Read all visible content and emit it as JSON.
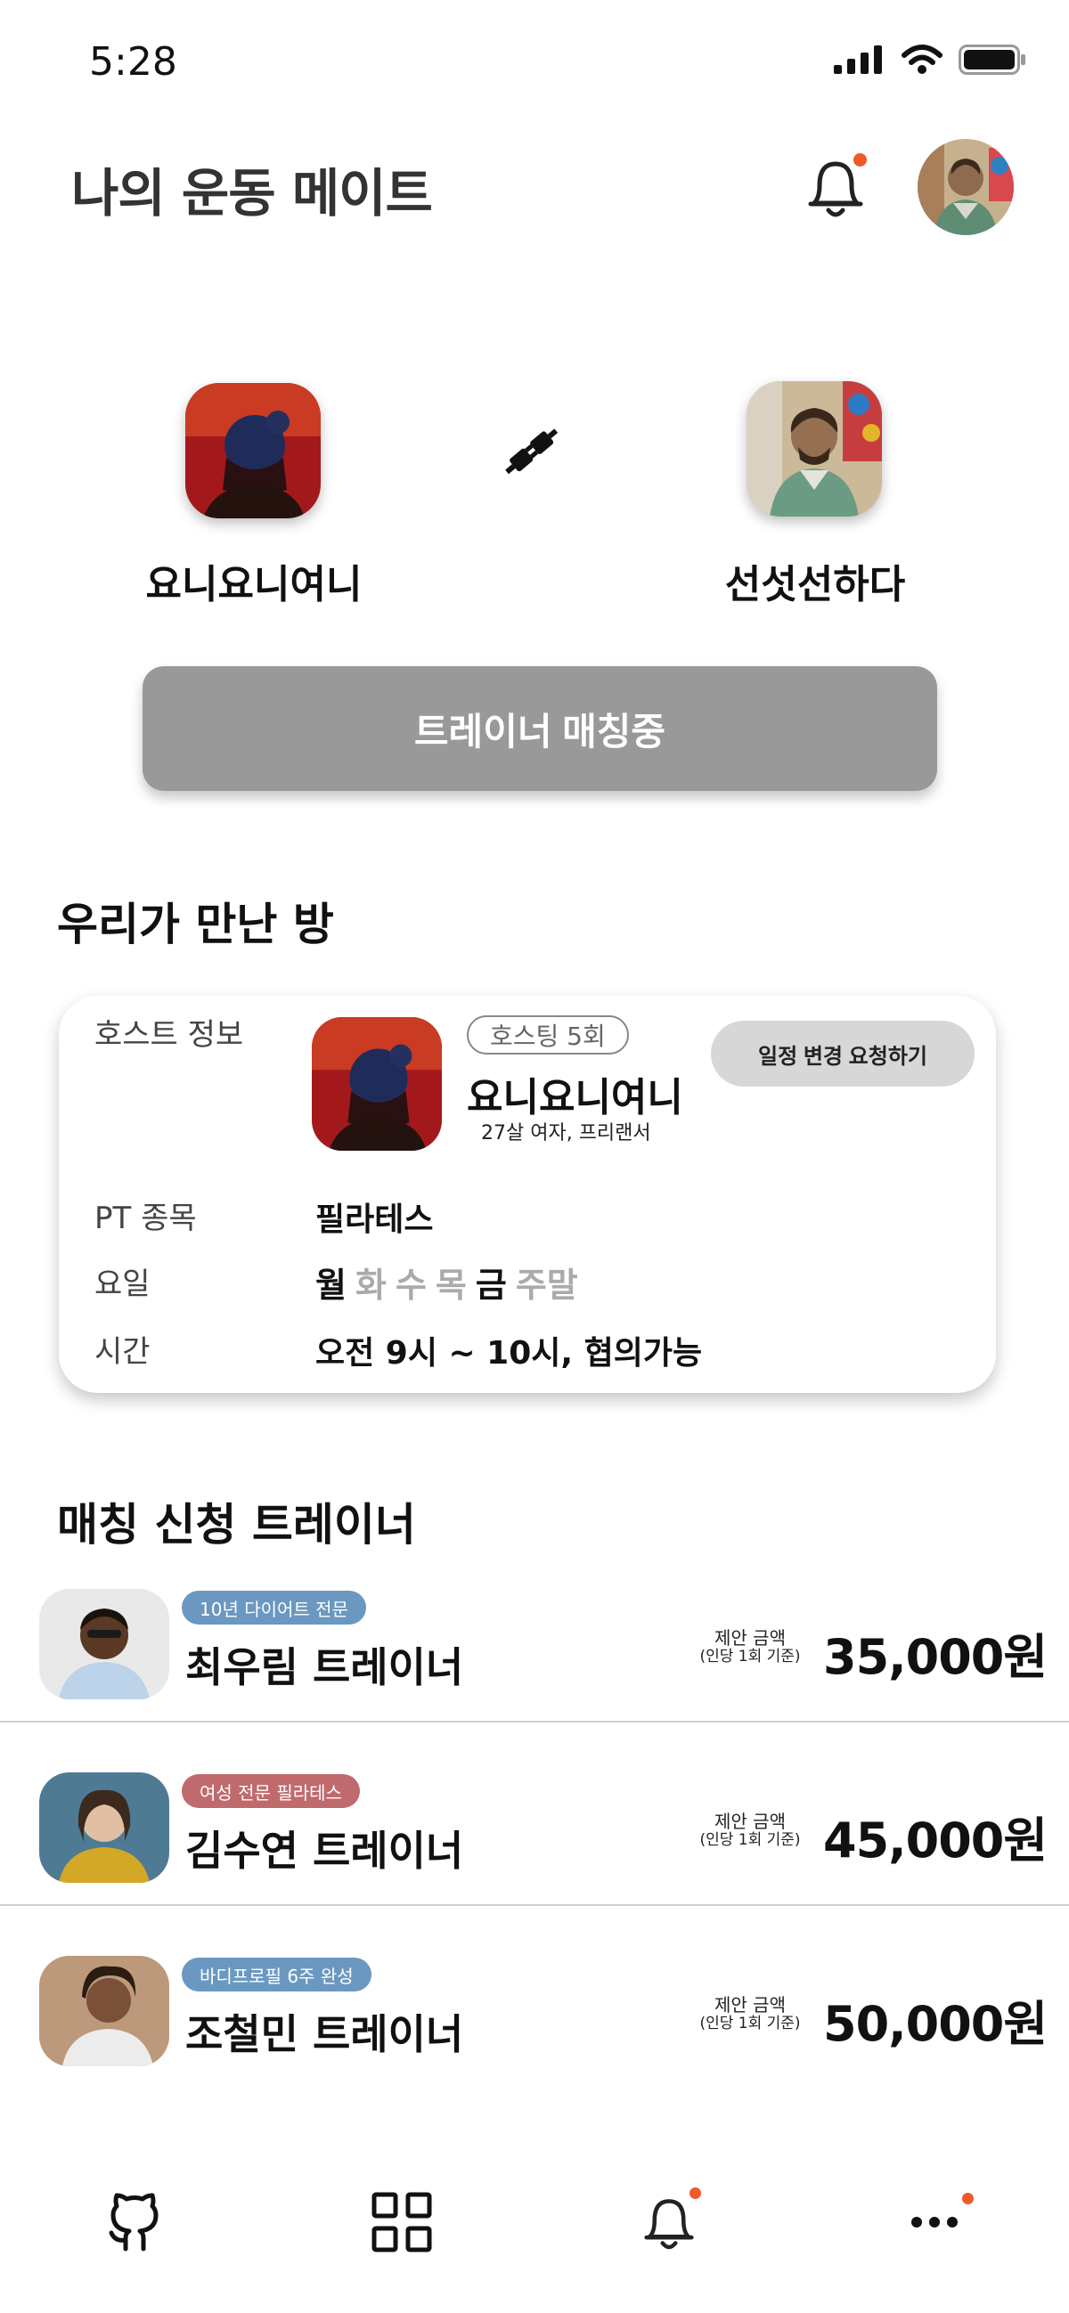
{
  "status_bar": {
    "time": "5:28"
  },
  "header": {
    "title": "나의 운동 메이트"
  },
  "match": {
    "left_user": "요니요니여니",
    "right_user": "선섯선하다",
    "status_button": "트레이너 매칭중"
  },
  "room": {
    "section_title": "우리가 만난 방",
    "host_label": "호스트 정보",
    "hosting_badge": "호스팅 5회",
    "host_name": "요니요니여니",
    "host_sub": "27살 여자, 프리랜서",
    "schedule_button": "일정 변경 요청하기",
    "pt_label": "PT 종목",
    "pt_value": "필라테스",
    "day_label": "요일",
    "days": [
      {
        "label": "월",
        "active": true
      },
      {
        "label": "화",
        "active": false
      },
      {
        "label": "수",
        "active": false
      },
      {
        "label": "목",
        "active": false
      },
      {
        "label": "금",
        "active": true
      },
      {
        "label": "주말",
        "active": false
      }
    ],
    "time_label": "시간",
    "time_value": "오전 9시 ~ 10시, 협의가능"
  },
  "trainers": {
    "section_title": "매칭 신청 트레이너",
    "offer_label": "제안 금액",
    "offer_note": "(인당 1회 기준)",
    "items": [
      {
        "badge": "10년 다이어트 전문",
        "badge_color": "#6a98c0",
        "name": "최우림 트레이너",
        "price": "35,000원"
      },
      {
        "badge": "여성 전문 필라테스",
        "badge_color": "#c06a6e",
        "name": "김수연 트레이너",
        "price": "45,000원"
      },
      {
        "badge": "바디프로필 6주 완성",
        "badge_color": "#6a98c0",
        "name": "조철민 트레이너",
        "price": "50,000원"
      }
    ]
  },
  "nav": {
    "items": [
      {
        "icon": "github-icon"
      },
      {
        "icon": "grid-icon"
      },
      {
        "icon": "bell-icon"
      },
      {
        "icon": "more-icon"
      }
    ]
  },
  "colors": {
    "accent_dot": "#f05a28",
    "button_gray": "#999999"
  }
}
